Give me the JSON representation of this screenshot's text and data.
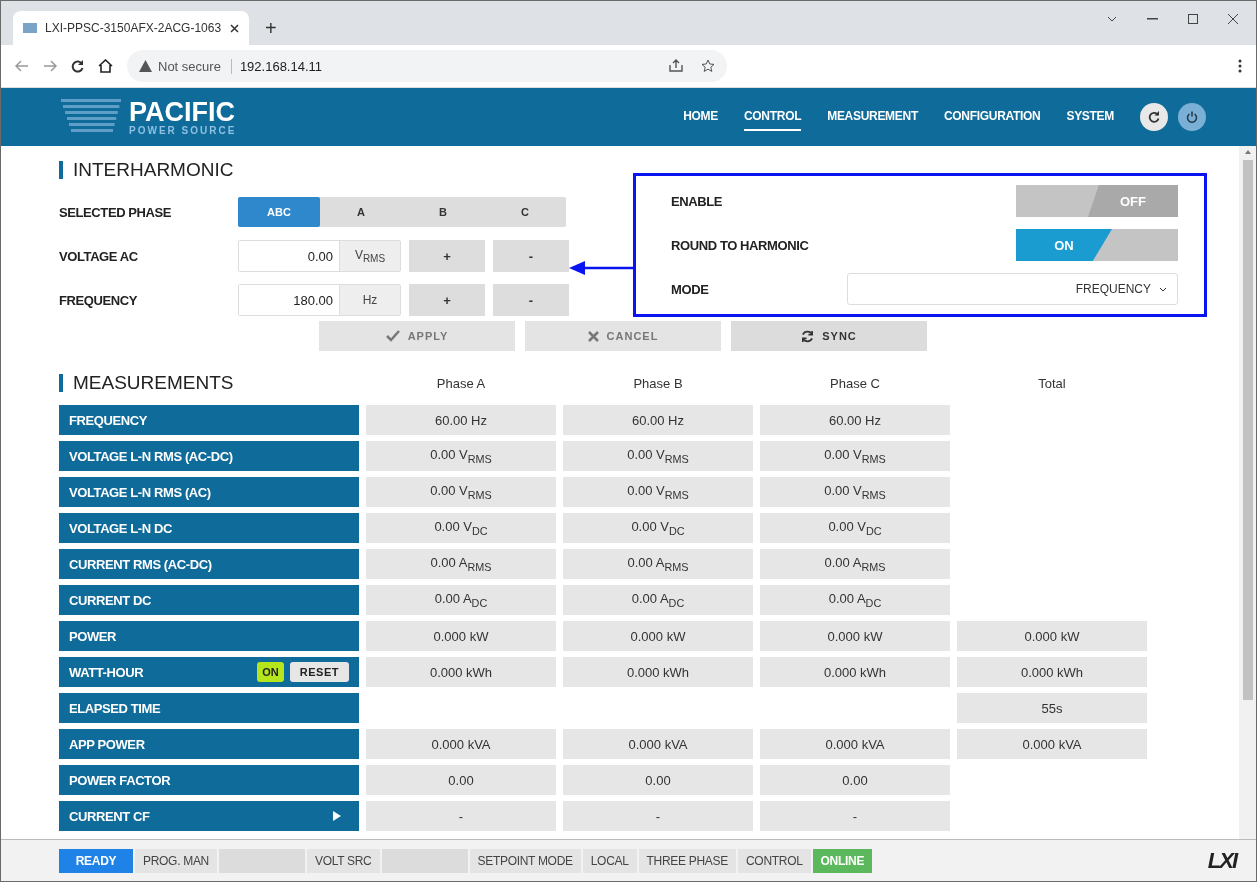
{
  "browser": {
    "tab_title": "LXI-PPSC-3150AFX-2ACG-1063",
    "new_tab": "+",
    "security": "Not secure",
    "url": "192.168.14.11"
  },
  "header": {
    "logo_title": "PACIFIC",
    "logo_subtitle": "POWER SOURCE",
    "nav": [
      {
        "label": "HOME",
        "selected": false
      },
      {
        "label": "CONTROL",
        "selected": true
      },
      {
        "label": "MEASUREMENT",
        "selected": false
      },
      {
        "label": "CONFIGURATION",
        "selected": false
      },
      {
        "label": "SYSTEM",
        "selected": false
      }
    ]
  },
  "interharmonic": {
    "title": "INTERHARMONIC",
    "phase_label": "SELECTED PHASE",
    "phases": [
      {
        "label": "ABC",
        "selected": true
      },
      {
        "label": "A",
        "selected": false
      },
      {
        "label": "B",
        "selected": false
      },
      {
        "label": "C",
        "selected": false
      }
    ],
    "fields": [
      {
        "label": "VOLTAGE AC",
        "value": "0.00",
        "unit": "V$_{RMS}$",
        "plus": "+",
        "minus": "-"
      },
      {
        "label": "FREQUENCY",
        "value": "180.00",
        "unit": "Hz",
        "plus": "+",
        "minus": "-"
      }
    ],
    "actions": [
      {
        "kind": "apply",
        "label": "APPLY"
      },
      {
        "kind": "cancel",
        "label": "CANCEL"
      },
      {
        "kind": "sync",
        "label": "SYNC"
      }
    ],
    "settings": {
      "enable": {
        "label": "ENABLE",
        "on": false,
        "text": "OFF"
      },
      "round": {
        "label": "ROUND TO HARMONIC",
        "on": true,
        "text": "ON"
      },
      "mode": {
        "label": "MODE",
        "value": "FREQUENCY"
      }
    }
  },
  "measurements": {
    "title": "MEASUREMENTS",
    "columns": [
      "Phase A",
      "Phase B",
      "Phase C",
      "Total"
    ],
    "rows": [
      {
        "label": "FREQUENCY",
        "cells": [
          {
            "text": "60.00 Hz"
          },
          {
            "text": "60.00 Hz"
          },
          {
            "text": "60.00 Hz"
          },
          {
            "kind": "empty"
          }
        ]
      },
      {
        "label": "VOLTAGE L-N RMS (AC-DC)",
        "cells": [
          {
            "text": "0.00 V$_{RMS}$"
          },
          {
            "text": "0.00 V$_{RMS}$"
          },
          {
            "text": "0.00 V$_{RMS}$"
          },
          {
            "kind": "empty"
          }
        ]
      },
      {
        "label": "VOLTAGE L-N RMS (AC)",
        "cells": [
          {
            "text": "0.00 V$_{RMS}$"
          },
          {
            "text": "0.00 V$_{RMS}$"
          },
          {
            "text": "0.00 V$_{RMS}$"
          },
          {
            "kind": "empty"
          }
        ]
      },
      {
        "label": "VOLTAGE L-N DC",
        "cells": [
          {
            "text": "0.00 V$_{DC}$"
          },
          {
            "text": "0.00 V$_{DC}$"
          },
          {
            "text": "0.00 V$_{DC}$"
          },
          {
            "kind": "empty"
          }
        ]
      },
      {
        "label": "CURRENT RMS (AC-DC)",
        "cells": [
          {
            "text": "0.00 A$_{RMS}$"
          },
          {
            "text": "0.00 A$_{RMS}$"
          },
          {
            "text": "0.00 A$_{RMS}$"
          },
          {
            "kind": "empty"
          }
        ]
      },
      {
        "label": "CURRENT DC",
        "cells": [
          {
            "text": "0.00 A$_{DC}$"
          },
          {
            "text": "0.00 A$_{DC}$"
          },
          {
            "text": "0.00 A$_{DC}$"
          },
          {
            "kind": "empty"
          }
        ]
      },
      {
        "label": "POWER",
        "cells": [
          {
            "text": "0.000 kW"
          },
          {
            "text": "0.000 kW"
          },
          {
            "text": "0.000 kW"
          },
          {
            "text": "0.000 kW"
          }
        ]
      },
      {
        "label": "WATT-HOUR",
        "kind": "watthour",
        "toggle": {
          "text": "ON",
          "on": true
        },
        "reset": "RESET",
        "cells": [
          {
            "text": "0.000 kWh"
          },
          {
            "text": "0.000 kWh"
          },
          {
            "text": "0.000 kWh"
          },
          {
            "text": "0.000 kWh"
          }
        ]
      },
      {
        "label": "ELAPSED TIME",
        "cells": [
          {
            "kind": "empty"
          },
          {
            "kind": "empty"
          },
          {
            "kind": "empty"
          },
          {
            "text": "55s"
          }
        ]
      },
      {
        "label": "APP POWER",
        "cells": [
          {
            "text": "0.000 kVA"
          },
          {
            "text": "0.000 kVA"
          },
          {
            "text": "0.000 kVA"
          },
          {
            "text": "0.000 kVA"
          }
        ]
      },
      {
        "label": "POWER FACTOR",
        "cells": [
          {
            "text": "0.00"
          },
          {
            "text": "0.00"
          },
          {
            "text": "0.00"
          },
          {
            "kind": "empty"
          }
        ]
      },
      {
        "label": "CURRENT CF",
        "kind": "expandable",
        "cells": [
          {
            "text": "-"
          },
          {
            "text": "-"
          },
          {
            "text": "-"
          },
          {
            "kind": "empty"
          }
        ]
      }
    ]
  },
  "status_bar": {
    "items": [
      {
        "kind": "ready",
        "label": "READY"
      },
      {
        "kind": "plain",
        "label": "PROG. MAN"
      },
      {
        "kind": "blank"
      },
      {
        "kind": "plain",
        "label": "VOLT SRC"
      },
      {
        "kind": "blank"
      },
      {
        "kind": "plain",
        "label": "SETPOINT MODE"
      },
      {
        "kind": "plain",
        "label": "LOCAL"
      },
      {
        "kind": "plain",
        "label": "THREE PHASE"
      },
      {
        "kind": "plain",
        "label": "CONTROL"
      },
      {
        "kind": "online",
        "label": "ONLINE"
      }
    ],
    "logo": "LXI"
  }
}
